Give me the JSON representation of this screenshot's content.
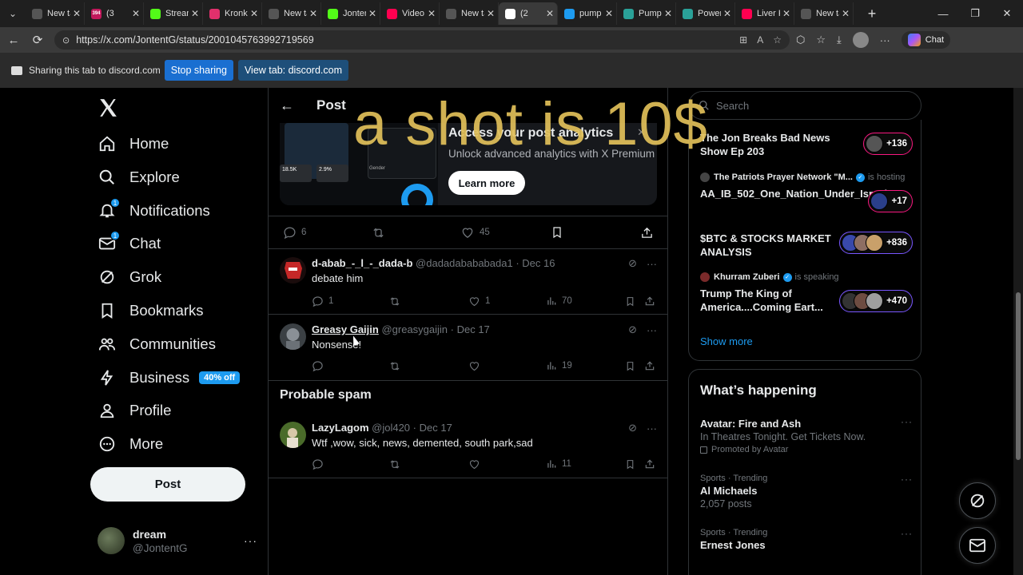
{
  "browser": {
    "tabs": [
      {
        "label": "New tab",
        "color": "#555"
      },
      {
        "label": "(3",
        "color": "#c2185b",
        "badge": "394"
      },
      {
        "label": "Stream",
        "color": "#53fc18"
      },
      {
        "label": "Kronke",
        "color": "#e1306c"
      },
      {
        "label": "New tab",
        "color": "#555"
      },
      {
        "label": "Jonten",
        "color": "#53fc18"
      },
      {
        "label": "Video",
        "color": "#ff0050"
      },
      {
        "label": "New tab",
        "color": "#555"
      },
      {
        "label": "(2",
        "color": "#ffffff",
        "active": true
      },
      {
        "label": "pump",
        "color": "#1d9bf0"
      },
      {
        "label": "Pump",
        "color": "#2aa198"
      },
      {
        "label": "Power",
        "color": "#2aa198"
      },
      {
        "label": "Liver K",
        "color": "#ff0050"
      },
      {
        "label": "New tab",
        "color": "#555"
      }
    ],
    "url": "https://x.com/JontentG/status/2001045763992719569",
    "chat_label": "Chat"
  },
  "share": {
    "text": "Sharing this tab to discord.com",
    "stop_label": "Stop sharing",
    "view_label": "View tab: discord.com"
  },
  "nav": {
    "items": [
      {
        "label": "Home",
        "icon": "home-icon"
      },
      {
        "label": "Explore",
        "icon": "search-icon"
      },
      {
        "label": "Notifications",
        "icon": "bell-icon",
        "badge": "1"
      },
      {
        "label": "Chat",
        "icon": "mail-icon",
        "badge": "1"
      },
      {
        "label": "Grok",
        "icon": "grok-icon"
      },
      {
        "label": "Bookmarks",
        "icon": "bookmark-icon"
      },
      {
        "label": "Communities",
        "icon": "communities-icon"
      },
      {
        "label": "Business",
        "icon": "lightning-icon",
        "promo": "40% off"
      },
      {
        "label": "Profile",
        "icon": "person-icon"
      },
      {
        "label": "More",
        "icon": "more-circle-icon"
      }
    ],
    "post_label": "Post",
    "account": {
      "name": "dream",
      "handle": "@JontentG"
    }
  },
  "main": {
    "title": "Post",
    "ad": {
      "title": "Access your post analytics",
      "subtitle": "Unlock advanced analytics with X Premium",
      "button": "Learn more",
      "stat1": "18.5K",
      "stat2": "2.9%",
      "gender": "Gender"
    },
    "post_actions": {
      "replies": "6",
      "likes": "45"
    },
    "replies": [
      {
        "name": "d-abab_-_l_-_dada-b",
        "handle": "@dadadabababada1",
        "date": "· Dec 16",
        "text": "debate him",
        "replies": "1",
        "likes": "1",
        "views": "70"
      },
      {
        "name": "Greasy Gaijin",
        "handle": "@greasygaijin",
        "date": "· Dec 17",
        "text": "Nonsense!",
        "replies": "",
        "likes": "",
        "views": "19"
      }
    ],
    "spam_title": "Probable spam",
    "spam_reply": {
      "name": "LazyLagom",
      "handle": "@jol420",
      "date": "· Dec 17",
      "text": "Wtf ,wow, sick, news, demented, south park,sad",
      "views": "11"
    }
  },
  "right": {
    "search_placeholder": "Search",
    "spaces": [
      {
        "host": "",
        "host_status": "",
        "title": "The Jon Breaks Bad News Show Ep 203",
        "count": "+136",
        "style": "pink"
      },
      {
        "host": "The Patriots Prayer Network \"M...",
        "host_status": "is hosting",
        "title": "AA_IB_502_One_Nation_Under_Israel",
        "count": "+17",
        "style": "pink"
      },
      {
        "host": "",
        "host_status": "",
        "title": "$BTC & STOCKS MARKET ANALYSIS",
        "count": "+836",
        "style": "purple"
      },
      {
        "host": "Khurram Zuberi",
        "host_status": "is speaking",
        "title": "Trump The King of America....Coming Eart...",
        "count": "+470",
        "style": "purple"
      }
    ],
    "show_more": "Show more",
    "happening_title": "What’s happening",
    "trends": [
      {
        "meta": "",
        "title": "Avatar: Fire and Ash",
        "sub": "In Theatres Tonight. Get Tickets Now.",
        "promo": "Promoted by Avatar"
      },
      {
        "meta": "Sports · Trending",
        "title": "Al Michaels",
        "sub": "2,057 posts",
        "promo": ""
      },
      {
        "meta": "Sports · Trending",
        "title": "Ernest Jones",
        "sub": "",
        "promo": ""
      }
    ]
  },
  "overlay_text": "a shot is 10$",
  "colors": {
    "accent": "#1d9bf0",
    "overlay": "#e2c15a",
    "live_pink": "#f91880",
    "live_purple": "#7856ff"
  }
}
